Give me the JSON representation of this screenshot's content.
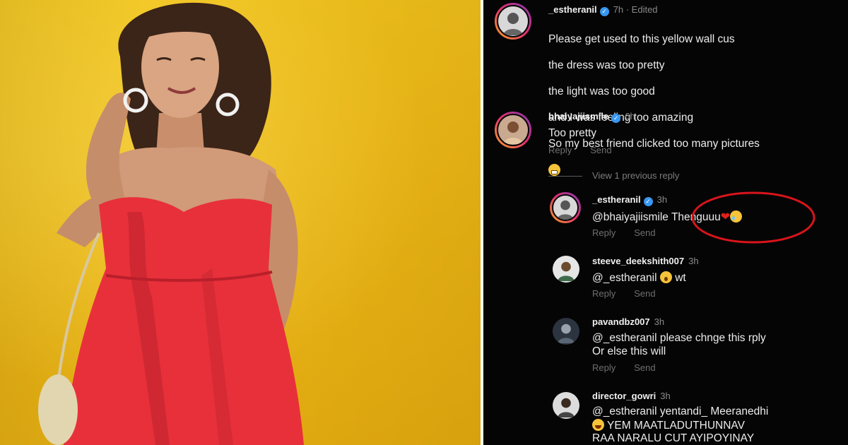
{
  "comments": [
    {
      "username": "_estheranil",
      "verified": true,
      "time": "7h · Edited",
      "lines": [
        "Please get used to this yellow wall cus",
        "the dress was too pretty",
        "the light was too good",
        "and I was feeling too amazing",
        "So my best friend clicked too many pictures"
      ],
      "emoji": "grimacing-face"
    },
    {
      "username": "bhaiyajiismile",
      "verified": true,
      "time": "6h",
      "text": "Too pretty",
      "reply_label": "Reply",
      "send_label": "Send"
    }
  ],
  "view_replies": "View 1 previous reply",
  "replies": [
    {
      "username": "_estheranil",
      "verified": true,
      "time": "3h",
      "mention": "@bhaiyajiismile",
      "text": "Thenguuu",
      "emojis": [
        "red-heart",
        "crying-face"
      ],
      "reply_label": "Reply",
      "send_label": "Send",
      "highlight_color": "#d9141b"
    },
    {
      "username": "steeve_deekshith007",
      "time": "3h",
      "text": "@_estheranil",
      "emoji": "astonished-face",
      "suffix": "wt",
      "reply_label": "Reply",
      "send_label": "Send"
    },
    {
      "username": "pavandbz007",
      "time": "3h",
      "line1": "@_estheranil please chnge this rply",
      "line2": "Or else this will",
      "reply_label": "Reply",
      "send_label": "Send"
    },
    {
      "username": "director_gowri",
      "time": "3h",
      "line1": "@_estheranil yentandi_ Meeranedhi",
      "line2": "YEM MAATLADUTHUNNAV",
      "line3": "RAA NARALU CUT AYIPOYINAY",
      "emoji": "tears-of-joy-face"
    }
  ],
  "colors": {
    "wall": "#f0c01c",
    "dress": "#e8303a",
    "panel_bg": "#050505",
    "verified": "#3897f0",
    "highlight": "#d9141b"
  }
}
